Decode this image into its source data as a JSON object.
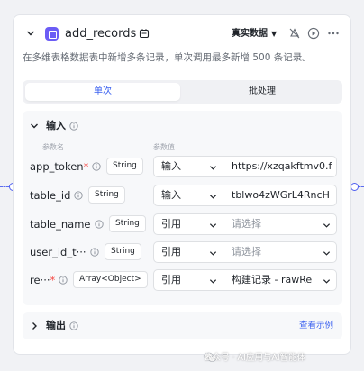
{
  "node": {
    "title": "add_records",
    "mode_label": "真实数据",
    "description": "在多维表格数据表中新增多条记录，单次调用最多新增 500 条记录。"
  },
  "tabs": [
    {
      "label": "单次",
      "active": true
    },
    {
      "label": "批处理",
      "active": false
    }
  ],
  "input_section": {
    "title": "输入",
    "col_name": "参数名",
    "col_value": "参数值",
    "params": [
      {
        "name": "app_token",
        "required": true,
        "type": "String",
        "source": "输入",
        "value": "https://xzqakftmv0.f",
        "placeholder": false
      },
      {
        "name": "table_id",
        "required": false,
        "type": "String",
        "source": "输入",
        "value": "tblwo4zWGrL4RncH",
        "placeholder": false
      },
      {
        "name": "table_name",
        "required": false,
        "type": "String",
        "source": "引用",
        "value": "请选择",
        "placeholder": true
      },
      {
        "name": "user_id_t···",
        "required": false,
        "type": "String",
        "source": "引用",
        "value": "请选择",
        "placeholder": true
      },
      {
        "name": "re···",
        "required": true,
        "type": "Array<Object>",
        "source": "引用",
        "value": "构建记录 - rawRe",
        "placeholder": false
      }
    ]
  },
  "output_section": {
    "title": "输出",
    "example_link": "查看示例"
  },
  "watermark": "公众号 · AI应用与AI智能体",
  "colors": {
    "accent": "#3c62f0",
    "node_icon": "#6b5cf5",
    "required": "#f54a45",
    "port": "#4e5ef0"
  }
}
